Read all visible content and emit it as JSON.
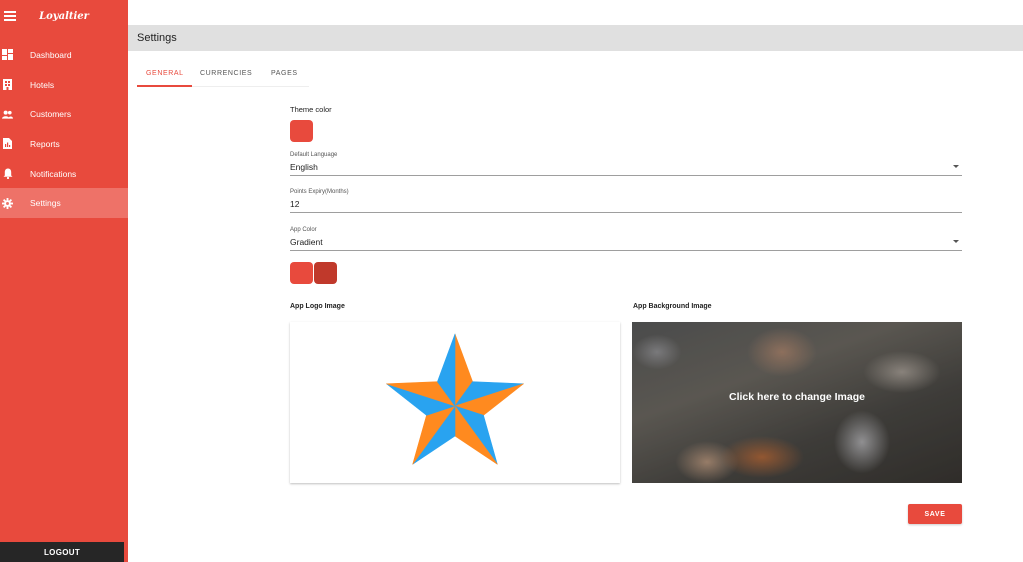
{
  "brand": {
    "logo_text": "Loyaltier",
    "accent_color": "#e84a3d"
  },
  "sidebar": {
    "items": [
      {
        "label": "Dashboard",
        "icon": "dashboard-icon"
      },
      {
        "label": "Hotels",
        "icon": "hotel-icon"
      },
      {
        "label": "Customers",
        "icon": "people-icon"
      },
      {
        "label": "Reports",
        "icon": "report-icon"
      },
      {
        "label": "Notifications",
        "icon": "bell-icon"
      },
      {
        "label": "Settings",
        "icon": "gear-icon",
        "active": true
      }
    ],
    "logout_label": "LOGOUT"
  },
  "header": {
    "title": "Settings"
  },
  "tabs": [
    {
      "label": "GENERAL",
      "active": true
    },
    {
      "label": "CURRENCIES"
    },
    {
      "label": "PAGES"
    }
  ],
  "form": {
    "theme_color": {
      "label": "Theme color",
      "value": "#e84a3d"
    },
    "default_language": {
      "label": "Default Language",
      "value": "English"
    },
    "points_expiry": {
      "label": "Points Expiry(Months)",
      "value": "12"
    },
    "app_color": {
      "label": "App Color",
      "value": "Gradient",
      "swatches": [
        "#e84a3d",
        "#c0392b"
      ]
    },
    "app_logo": {
      "label": "App Logo Image",
      "icon": "star-logo-image",
      "colors": [
        "#ff8a1f",
        "#29a3f0"
      ]
    },
    "app_background": {
      "label": "App Background Image",
      "overlay_text": "Click here to change Image"
    }
  },
  "actions": {
    "save_label": "SAVE"
  }
}
